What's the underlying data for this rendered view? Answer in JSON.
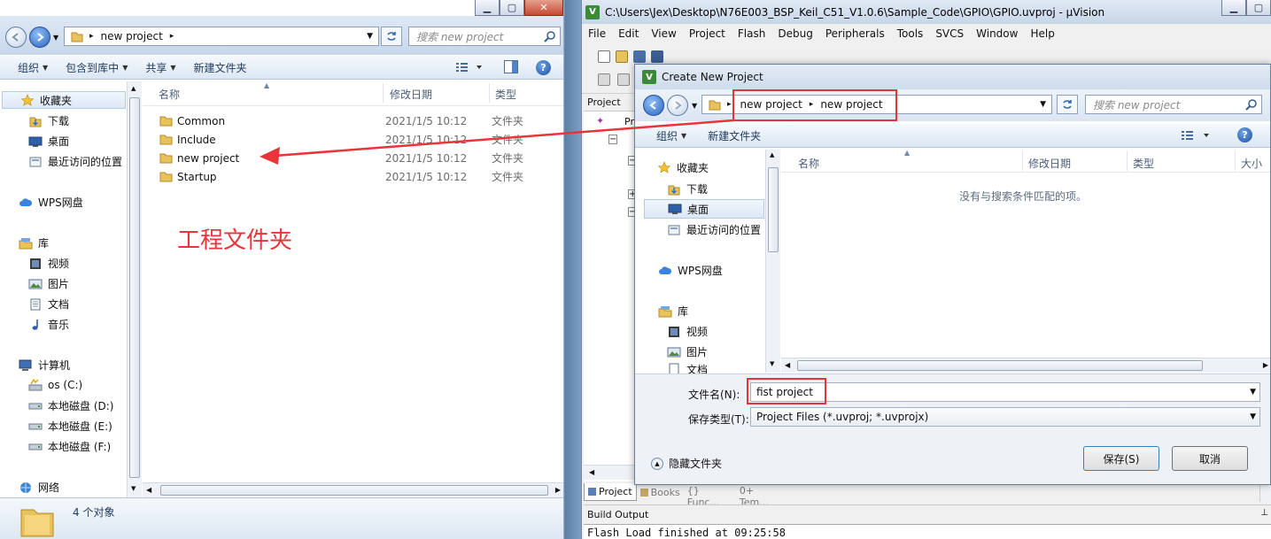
{
  "explorer": {
    "address": {
      "segment": "new project"
    },
    "search_placeholder": "搜索 new project",
    "toolbar": {
      "organize": "组织",
      "include_in_library": "包含到库中",
      "share": "共享",
      "new_folder": "新建文件夹"
    },
    "nav": {
      "favorites": "收藏夹",
      "downloads": "下载",
      "desktop": "桌面",
      "recent": "最近访问的位置",
      "wps": "WPS网盘",
      "libraries": "库",
      "videos": "视频",
      "pictures": "图片",
      "documents": "文档",
      "music": "音乐",
      "computer": "计算机",
      "drive_c": "os (C:)",
      "drive_d": "本地磁盘 (D:)",
      "drive_e": "本地磁盘 (E:)",
      "drive_f": "本地磁盘 (F:)",
      "network": "网络"
    },
    "columns": {
      "name": "名称",
      "date": "修改日期",
      "type": "类型"
    },
    "files": [
      {
        "name": "Common",
        "date": "2021/1/5 10:12",
        "type": "文件夹"
      },
      {
        "name": "Include",
        "date": "2021/1/5 10:12",
        "type": "文件夹"
      },
      {
        "name": "new project",
        "date": "2021/1/5 10:12",
        "type": "文件夹"
      },
      {
        "name": "Startup",
        "date": "2021/1/5 10:12",
        "type": "文件夹"
      }
    ],
    "status": "4 个对象"
  },
  "annotation": {
    "label": "工程文件夹",
    "color": "#e8343b"
  },
  "uvision": {
    "title": "C:\\Users\\Jex\\Desktop\\N76E003_BSP_Keil_C51_V1.0.6\\Sample_Code\\GPIO\\GPIO.uvproj - µVision",
    "menu": [
      "File",
      "Edit",
      "View",
      "Project",
      "Flash",
      "Debug",
      "Peripherals",
      "Tools",
      "SVCS",
      "Window",
      "Help"
    ],
    "project_panel": {
      "title": "Project",
      "root": "Pro"
    },
    "tabs": [
      "Project",
      "Books",
      "{} Func...",
      "0+ Tem..."
    ],
    "build_output": {
      "title": "Build Output",
      "line": "Flash Load finished at 09:25:58"
    }
  },
  "dialog": {
    "title": "Create New Project",
    "address": {
      "seg1": "new project",
      "seg2": "new project"
    },
    "search_placeholder": "搜索 new project",
    "toolbar": {
      "organize": "组织",
      "new_folder": "新建文件夹"
    },
    "nav": {
      "favorites": "收藏夹",
      "downloads": "下载",
      "desktop": "桌面",
      "recent": "最近访问的位置",
      "wps": "WPS网盘",
      "libraries": "库",
      "videos": "视频",
      "pictures": "图片",
      "documents": "文档"
    },
    "columns": {
      "name": "名称",
      "date": "修改日期",
      "type": "类型",
      "size": "大小"
    },
    "empty_message": "没有与搜索条件匹配的项。",
    "filename_label": "文件名(N):",
    "filename_value": "fist project",
    "filetype_label": "保存类型(T):",
    "filetype_value": "Project Files (*.uvproj; *.uvprojx)",
    "hide_folders": "隐藏文件夹",
    "save": "保存(S)",
    "cancel": "取消"
  },
  "colors": {
    "highlight_red": "#e1363a",
    "folder_yellow": "#e8c25a"
  }
}
